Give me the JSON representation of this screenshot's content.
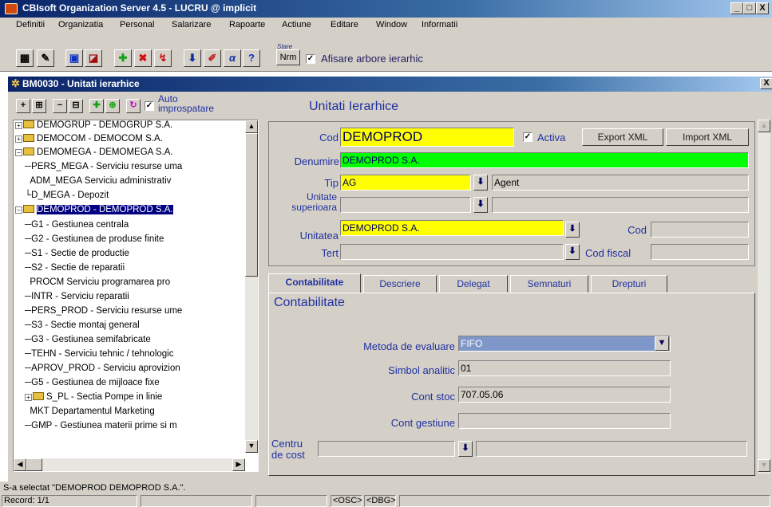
{
  "window": {
    "title": "CBIsoft Organization Server 4.5 - LUCRU @ implicit",
    "controls": [
      "_",
      "□",
      "X"
    ]
  },
  "menu": [
    "Definitii",
    "Organizatia",
    "Personal",
    "Salarizare",
    "Rapoarte",
    "Actiune",
    "Editare",
    "Window",
    "Informatii"
  ],
  "toolbar": {
    "stare_label": "Stare",
    "nrm_label": "Nrm",
    "afisare_label": "Afisare arbore ierarhic",
    "afisare_checked": true
  },
  "child": {
    "title": "BM0030 - Unitati ierarhice",
    "close": "X",
    "auto_label_1": "Auto",
    "auto_label_2": "improspatare",
    "heading": "Unitati Ierarhice"
  },
  "tree": [
    {
      "text": "DEMOGRUP - DEMOGRUP S.A.",
      "kind": "folder"
    },
    {
      "text": "DEMOCOM - DEMOCOM S.A.",
      "kind": "folder"
    },
    {
      "text": "DEMOMEGA - DEMOMEGA S.A.",
      "kind": "folder"
    },
    {
      "text": "PERS_MEGA - Serviciu resurse uma",
      "kind": "leaf"
    },
    {
      "text": "ADM_MEGA  Serviciu administrativ",
      "kind": "leaf"
    },
    {
      "text": "D_MEGA - Depozit",
      "kind": "leaf"
    },
    {
      "text": "DEMOPROD - DEMOPROD S.A.",
      "kind": "folder",
      "selected": true
    },
    {
      "text": "G1 - Gestiunea centrala",
      "kind": "leaf"
    },
    {
      "text": "G2 - Gestiunea de produse finite",
      "kind": "leaf"
    },
    {
      "text": "S1 - Sectie de productie",
      "kind": "leaf"
    },
    {
      "text": "S2 - Sectie de reparatii",
      "kind": "leaf"
    },
    {
      "text": "PROCM  Serviciu programarea pro",
      "kind": "leaf"
    },
    {
      "text": "INTR - Serviciu reparatii",
      "kind": "leaf"
    },
    {
      "text": "PERS_PROD - Serviciu resurse ume",
      "kind": "leaf"
    },
    {
      "text": "S3 - Sectie montaj general",
      "kind": "leaf"
    },
    {
      "text": "G3 - Gestiunea semifabricate",
      "kind": "leaf"
    },
    {
      "text": "TEHN - Serviciu tehnic / tehnologic",
      "kind": "leaf"
    },
    {
      "text": "APROV_PROD - Serviciu aprovizion",
      "kind": "leaf"
    },
    {
      "text": "G5 - Gestiunea de mijloace fixe",
      "kind": "leaf"
    },
    {
      "text": "S_PL - Sectia Pompe in linie",
      "kind": "folder"
    },
    {
      "text": "MKT  Departamentul Marketing",
      "kind": "leaf"
    },
    {
      "text": "GMP - Gestiunea materii prime si m",
      "kind": "leaf"
    }
  ],
  "form": {
    "cod_label": "Cod",
    "cod_value": "DEMOPROD",
    "activa_label": "Activa",
    "activa_checked": true,
    "export_label": "Export XML",
    "import_label": "Import XML",
    "denumire_label": "Denumire",
    "denumire_value": "DEMOPROD S.A.",
    "tip_label": "Tip",
    "tip_value": "AG",
    "tip_desc": "Agent",
    "unit_sup_label_1": "Unitate",
    "unit_sup_label_2": "superioara",
    "unit_sup_value": "",
    "unitatea_label": "Unitatea",
    "unitatea_value": "DEMOPROD S.A.",
    "cod2_label": "Cod",
    "tert_label": "Tert",
    "cod_fiscal_label": "Cod fiscal"
  },
  "tabs": [
    "Contabilitate",
    "Descriere",
    "Delegat",
    "Semnaturi",
    "Drepturi"
  ],
  "contab": {
    "heading": "Contabilitate",
    "metoda_label": "Metoda de evaluare",
    "metoda_value": "FIFO",
    "simbol_label": "Simbol analitic",
    "simbol_value": "01",
    "cont_stoc_label": "Cont stoc",
    "cont_stoc_value": "707.05.06",
    "cont_gest_label": "Cont gestiune",
    "centru_label_1": "Centru",
    "centru_label_2": "de cost"
  },
  "status": {
    "message": "S-a selectat \"DEMOPROD  DEMOPROD S.A.\".",
    "record": "Record: 1/1",
    "osc": "<OSC>",
    "dbg": "<DBG>"
  }
}
